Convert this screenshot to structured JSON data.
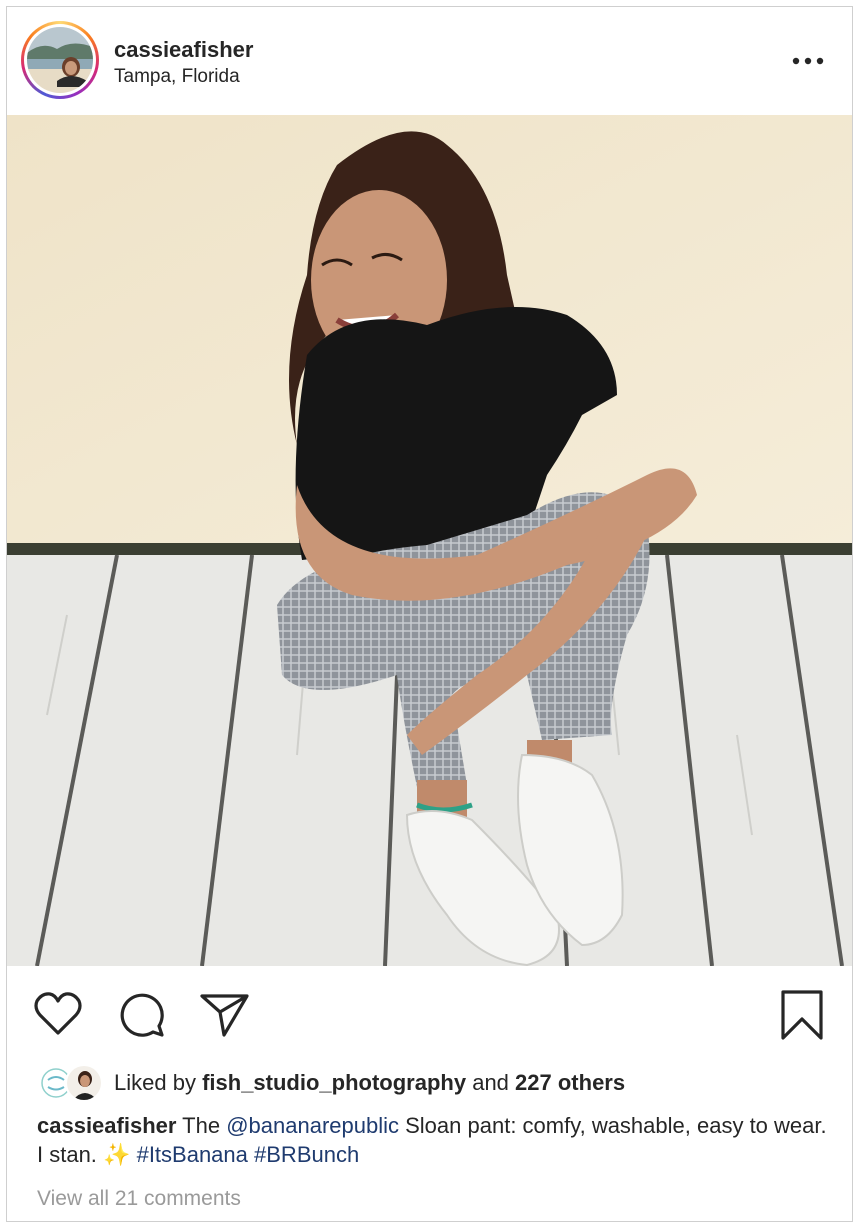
{
  "post": {
    "username": "cassieafisher",
    "location": "Tampa, Florida",
    "more_icon": "more-horizontal-icon"
  },
  "actions": {
    "icons": [
      "heart-icon",
      "comment-icon",
      "share-icon",
      "bookmark-icon"
    ]
  },
  "likes": {
    "prefix": "Liked by",
    "liker": "fish_studio_photography",
    "middle": "and",
    "others": "227 others",
    "liker_avatar_text": "fish studio"
  },
  "caption": {
    "username": "cassieafisher",
    "text_1": "The",
    "mention": "@bananarepublic",
    "text_2": "Sloan pant: comfy, washable, easy to wear. I stan.",
    "emoji": "✨",
    "hashtag_1": "#ItsBanana",
    "hashtag_2": "#BRBunch"
  },
  "comments": {
    "view_all": "View all 21 comments"
  },
  "colors": {
    "text": "#262626",
    "link": "#1f3b6f",
    "muted": "#9a9a9a",
    "wall": "#f1e7cf",
    "deck": "#e6e6e3"
  }
}
